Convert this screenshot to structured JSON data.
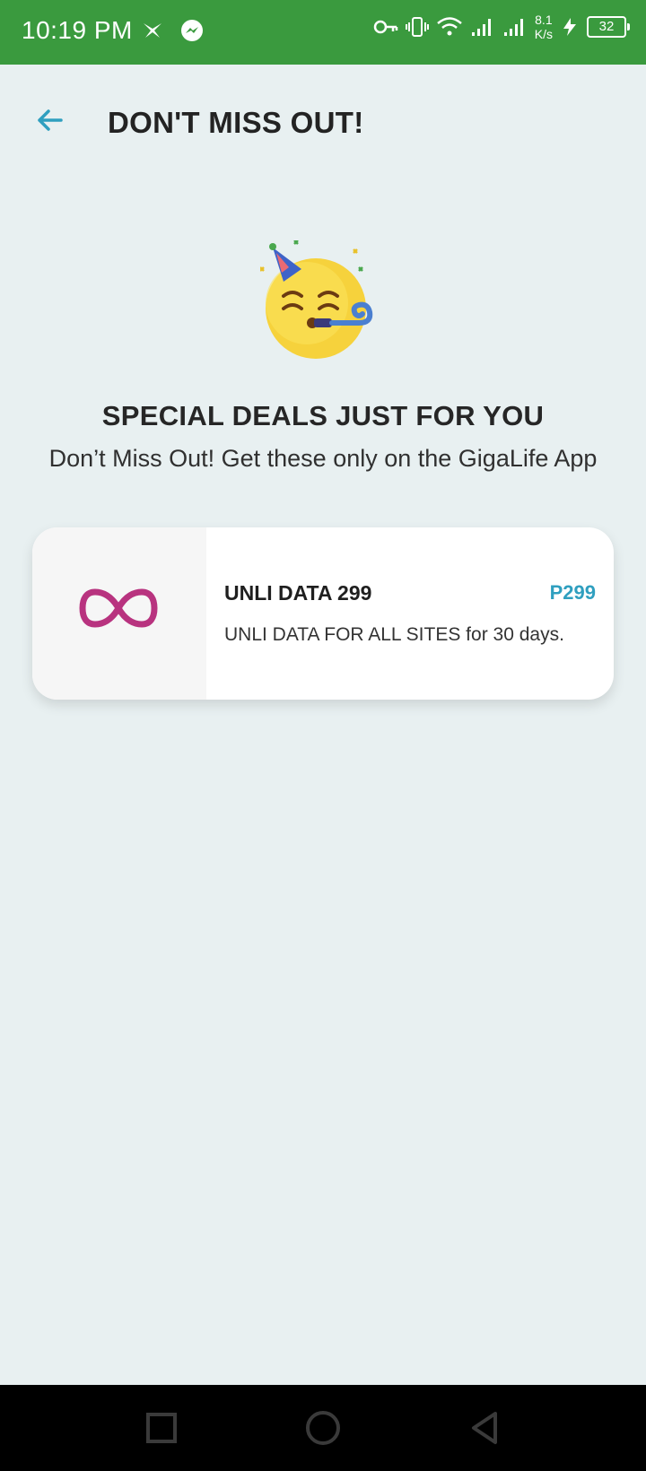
{
  "status_bar": {
    "time": "10:19 PM",
    "net_speed_value": "8.1",
    "net_speed_unit": "K/s",
    "battery": "32",
    "icons": [
      "bird-icon",
      "messenger-icon",
      "key-icon",
      "vibrate-icon",
      "wifi-icon",
      "signal-icon",
      "signal-icon",
      "charging-icon",
      "battery-icon"
    ]
  },
  "header": {
    "back_icon": "arrow-left-icon",
    "title": "DON'T MISS OUT!"
  },
  "hero": {
    "icon": "party-face-icon",
    "title": "SPECIAL DEALS JUST FOR YOU",
    "subtitle": "Don’t Miss Out! Get these only on the GigaLife App"
  },
  "deals": [
    {
      "icon": "infinity-icon",
      "name": "UNLI DATA 299",
      "price": "P299",
      "description": "UNLI DATA FOR ALL SITES for 30 days."
    }
  ],
  "nav_bar": {
    "buttons": [
      "recents-square-icon",
      "home-circle-icon",
      "back-triangle-icon"
    ]
  },
  "colors": {
    "status_bar": "#3a9a3e",
    "background": "#e8f0f1",
    "accent": "#2f9fbf",
    "infinity": "#b8337f"
  }
}
